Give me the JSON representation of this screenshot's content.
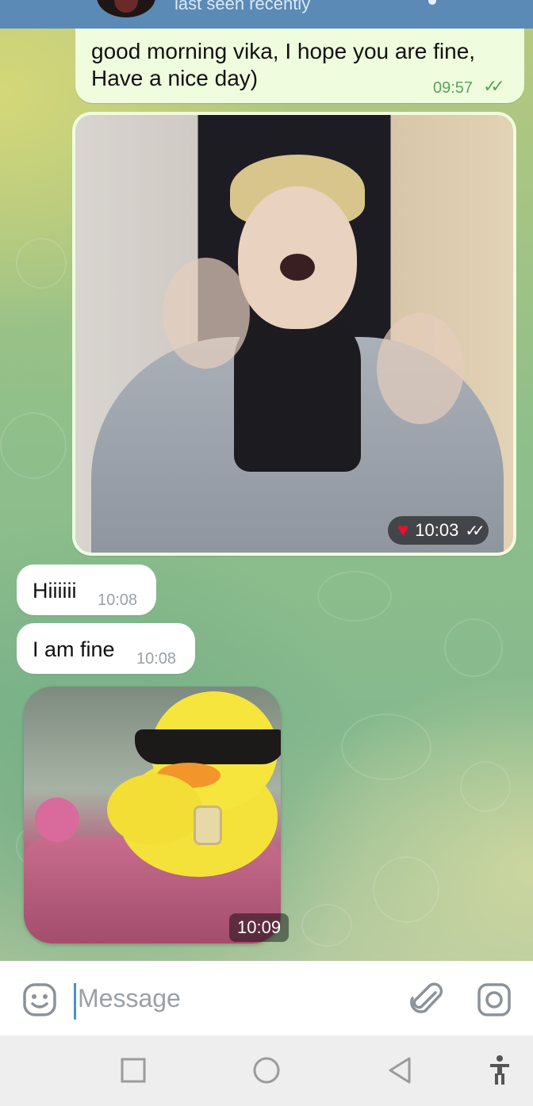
{
  "header": {
    "status": "last seen recently"
  },
  "messages": [
    {
      "direction": "outgoing",
      "type": "text",
      "lines": [
        "good morning vika, I hope you are fine,",
        "Have a nice day)"
      ],
      "time": "09:57",
      "read": true
    },
    {
      "direction": "outgoing",
      "type": "photo",
      "reaction": "heart",
      "time": "10:03",
      "read": true
    },
    {
      "direction": "incoming",
      "type": "text",
      "text": "Hiiiiii",
      "time": "10:08"
    },
    {
      "direction": "incoming",
      "type": "text",
      "text": "I am fine",
      "time": "10:08"
    },
    {
      "direction": "incoming",
      "type": "sticker",
      "sticker": "duck-in-sunglasses",
      "time": "10:09"
    }
  ],
  "composer": {
    "placeholder": "Message",
    "left_icon": "sticker-icon",
    "right_icons": [
      "paperclip-icon",
      "camera-icon"
    ]
  },
  "navigation": {
    "buttons": [
      "recents-button",
      "home-button",
      "back-button",
      "accessibility-button"
    ]
  },
  "colors": {
    "outgoing_bubble": "#effdde",
    "incoming_bubble": "#ffffff",
    "outgoing_time": "#5aa45c",
    "header": "#5b8ab6",
    "caret": "#4b8fd1"
  }
}
